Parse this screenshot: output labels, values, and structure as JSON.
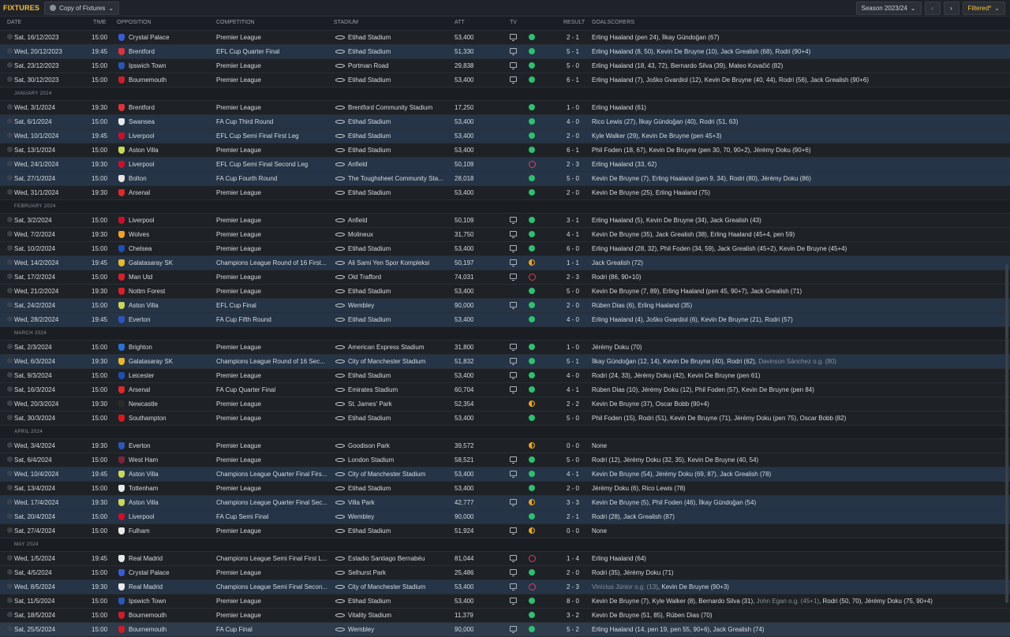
{
  "header": {
    "title": "FIXTURES",
    "view_label": "Copy of Fixtures",
    "season_label": "Season 2023/24",
    "filter_label": "Filtered*"
  },
  "columns": {
    "date": "DATE",
    "time": "TIME",
    "opposition": "OPPOSITION",
    "competition": "COMPETITION",
    "stadium": "STADIUM",
    "att": "ATT",
    "tv": "TV",
    "result": "RESULT",
    "goalscorers": "GOALSCORERS"
  },
  "colors": {
    "win": "#2fbf71",
    "loss": "#e0405a",
    "draw": "#e8a628",
    "accent": "#f3c13a"
  },
  "months": [
    "JANUARY 2024",
    "FEBRUARY 2024",
    "MARCH 2024",
    "APRIL 2024",
    "MAY 2024"
  ],
  "fixtures": [
    {
      "date": "Sat, 16/12/2023",
      "time": "15:00",
      "opp": "Crystal Palace",
      "crest": "#3a5bd0",
      "comp": "Premier League",
      "stadium": "Etihad Stadium",
      "att": "53,400",
      "tv": true,
      "res": "W",
      "score": "2 - 1",
      "scorers": "Erling Haaland (pen 24), İlkay Gündoğan (67)",
      "hl": false
    },
    {
      "date": "Wed, 20/12/2023",
      "time": "19:45",
      "opp": "Brentford",
      "crest": "#d8343b",
      "comp": "EFL Cup Quarter Final",
      "stadium": "Etihad Stadium",
      "att": "51,330",
      "tv": true,
      "res": "W",
      "score": "5 - 1",
      "scorers": "Erling Haaland (8, 50), Kevin De Bruyne (10), Jack Grealish (68), Rodri (90+4)",
      "hl": true
    },
    {
      "date": "Sat, 23/12/2023",
      "time": "15:00",
      "opp": "Ipswich Town",
      "crest": "#2a56b3",
      "comp": "Premier League",
      "stadium": "Portman Road",
      "att": "29,838",
      "tv": true,
      "res": "W",
      "score": "5 - 0",
      "scorers": "Erling Haaland (18, 43, 72), Bernardo Silva (39), Mateo Kovačić (82)",
      "hl": false
    },
    {
      "date": "Sat, 30/12/2023",
      "time": "15:00",
      "opp": "Bournemouth",
      "crest": "#c81f2c",
      "comp": "Premier League",
      "stadium": "Etihad Stadium",
      "att": "53,400",
      "tv": true,
      "res": "W",
      "score": "6 - 1",
      "scorers": "Erling Haaland (7), Joško Gvardiol (12), Kevin De Bruyne (40, 44), Rodri (56), Jack Grealish (90+6)",
      "hl": false
    },
    {
      "month": "JANUARY 2024"
    },
    {
      "date": "Wed, 3/1/2024",
      "time": "19:30",
      "opp": "Brentford",
      "crest": "#d8343b",
      "comp": "Premier League",
      "stadium": "Brentford Community Stadium",
      "att": "17,250",
      "tv": false,
      "res": "W",
      "score": "1 - 0",
      "scorers": "Erling Haaland (61)",
      "hl": false
    },
    {
      "date": "Sat, 6/1/2024",
      "time": "15:00",
      "opp": "Swansea",
      "crest": "#e9e9e9",
      "comp": "FA Cup Third Round",
      "stadium": "Etihad Stadium",
      "att": "53,400",
      "tv": false,
      "res": "W",
      "score": "4 - 0",
      "scorers": "Rico Lewis (27), İlkay Gündoğan (40), Rodri (51, 63)",
      "hl": true
    },
    {
      "date": "Wed, 10/1/2024",
      "time": "19:45",
      "opp": "Liverpool",
      "crest": "#c8102e",
      "comp": "EFL Cup Semi Final First Leg",
      "stadium": "Etihad Stadium",
      "att": "53,400",
      "tv": false,
      "res": "W",
      "score": "2 - 0",
      "scorers": "Kyle Walker (29), Kevin De Bruyne (pen 45+3)",
      "hl": true
    },
    {
      "date": "Sat, 13/1/2024",
      "time": "15:00",
      "opp": "Aston Villa",
      "crest": "#c9d65a",
      "comp": "Premier League",
      "stadium": "Etihad Stadium",
      "att": "53,400",
      "tv": false,
      "res": "W",
      "score": "6 - 1",
      "scorers": "Phil Foden (18, 67), Kevin De Bruyne (pen 30, 70, 90+2), Jérémy Doku (90+6)",
      "hl": false
    },
    {
      "date": "Wed, 24/1/2024",
      "time": "19:30",
      "opp": "Liverpool",
      "crest": "#c8102e",
      "comp": "EFL Cup Semi Final Second Leg",
      "stadium": "Anfield",
      "att": "50,109",
      "tv": false,
      "res": "L",
      "score": "2 - 3",
      "scorers": "Erling Haaland (33, 62)",
      "hl": true
    },
    {
      "date": "Sat, 27/1/2024",
      "time": "15:00",
      "opp": "Bolton",
      "crest": "#e6e6e6",
      "comp": "FA Cup Fourth Round",
      "stadium": "The Toughsheet Community Sta...",
      "att": "28,018",
      "tv": false,
      "res": "W",
      "score": "5 - 0",
      "scorers": "Kevin De Bruyne (7), Erling Haaland (pen 9, 34), Rodri (80), Jérémy Doku (86)",
      "hl": true
    },
    {
      "date": "Wed, 31/1/2024",
      "time": "19:30",
      "opp": "Arsenal",
      "crest": "#db2a2a",
      "comp": "Premier League",
      "stadium": "Etihad Stadium",
      "att": "53,400",
      "tv": false,
      "res": "W",
      "score": "2 - 0",
      "scorers": "Kevin De Bruyne (25), Erling Haaland (75)",
      "hl": false
    },
    {
      "month": "FEBRUARY 2024"
    },
    {
      "date": "Sat, 3/2/2024",
      "time": "15:00",
      "opp": "Liverpool",
      "crest": "#c8102e",
      "comp": "Premier League",
      "stadium": "Anfield",
      "att": "50,109",
      "tv": true,
      "res": "W",
      "score": "3 - 1",
      "scorers": "Erling Haaland (5), Kevin De Bruyne (34), Jack Grealish (43)",
      "hl": false
    },
    {
      "date": "Wed, 7/2/2024",
      "time": "19:30",
      "opp": "Wolves",
      "crest": "#f0a12d",
      "comp": "Premier League",
      "stadium": "Molineux",
      "att": "31,750",
      "tv": true,
      "res": "W",
      "score": "4 - 1",
      "scorers": "Kevin De Bruyne (35), Jack Grealish (38), Erling Haaland (45+4, pen 59)",
      "hl": false
    },
    {
      "date": "Sat, 10/2/2024",
      "time": "15:00",
      "opp": "Chelsea",
      "crest": "#1b4fb5",
      "comp": "Premier League",
      "stadium": "Etihad Stadium",
      "att": "53,400",
      "tv": true,
      "res": "W",
      "score": "6 - 0",
      "scorers": "Erling Haaland (28, 32), Phil Foden (34, 59), Jack Grealish (45+2), Kevin De Bruyne (45+4)",
      "hl": false
    },
    {
      "date": "Wed, 14/2/2024",
      "time": "19:45",
      "opp": "Galatasaray SK",
      "crest": "#e6b632",
      "comp": "Champions League Round of 16 First...",
      "stadium": "Ali Sami Yen Spor Kompleksi",
      "att": "50,197",
      "tv": true,
      "res": "D",
      "score": "1 - 1",
      "scorers": "Jack Grealish (72)",
      "hl": true
    },
    {
      "date": "Sat, 17/2/2024",
      "time": "15:00",
      "opp": "Man Utd",
      "crest": "#d3202f",
      "comp": "Premier League",
      "stadium": "Old Trafford",
      "att": "74,031",
      "tv": true,
      "res": "L",
      "score": "2 - 3",
      "scorers": "Rodri (86, 90+10)",
      "hl": false
    },
    {
      "date": "Wed, 21/2/2024",
      "time": "19:30",
      "opp": "Nottm Forest",
      "crest": "#d2222c",
      "comp": "Premier League",
      "stadium": "Etihad Stadium",
      "att": "53,400",
      "tv": false,
      "res": "W",
      "score": "5 - 0",
      "scorers": "Kevin De Bruyne (7, 89), Erling Haaland (pen 45, 90+7), Jack Grealish (71)",
      "hl": false
    },
    {
      "date": "Sat, 24/2/2024",
      "time": "15:00",
      "opp": "Aston Villa",
      "crest": "#c9d65a",
      "comp": "EFL Cup Final",
      "stadium": "Wembley",
      "att": "90,000",
      "tv": true,
      "res": "W",
      "score": "2 - 0",
      "scorers": "Rúben Dias (6), Erling Haaland (35)",
      "hl": true
    },
    {
      "date": "Wed, 28/2/2024",
      "time": "19:45",
      "opp": "Everton",
      "crest": "#2f55b8",
      "comp": "FA Cup Fifth Round",
      "stadium": "Etihad Stadium",
      "att": "53,400",
      "tv": false,
      "res": "W",
      "score": "4 - 0",
      "scorers": "Erling Haaland (4), Joško Gvardiol (6), Kevin De Bruyne (21), Rodri (57)",
      "hl": true
    },
    {
      "month": "MARCH 2024"
    },
    {
      "date": "Sat, 2/3/2024",
      "time": "15:00",
      "opp": "Brighton",
      "crest": "#2b6fd1",
      "comp": "Premier League",
      "stadium": "American Express Stadium",
      "att": "31,800",
      "tv": true,
      "res": "W",
      "score": "1 - 0",
      "scorers": "Jérémy Doku (70)",
      "hl": false
    },
    {
      "date": "Wed, 6/3/2024",
      "time": "19:30",
      "opp": "Galatasaray SK",
      "crest": "#e6b632",
      "comp": "Champions League Round of 16 Sec...",
      "stadium": "City of Manchester Stadium",
      "att": "51,832",
      "tv": true,
      "res": "W",
      "score": "5 - 1",
      "scorers": "İlkay Gündoğan (12, 14), Kevin De Bruyne (40), Rodri (62), ",
      "og": "Davinson Sánchez o.g. (80)",
      "hl": true
    },
    {
      "date": "Sat, 9/3/2024",
      "time": "15:00",
      "opp": "Leicester",
      "crest": "#1e4fb0",
      "comp": "Premier League",
      "stadium": "Etihad Stadium",
      "att": "53,400",
      "tv": true,
      "res": "W",
      "score": "4 - 0",
      "scorers": "Rodri (24, 33), Jérémy Doku (42), Kevin De Bruyne (pen 61)",
      "hl": false
    },
    {
      "date": "Sat, 16/3/2024",
      "time": "15:00",
      "opp": "Arsenal",
      "crest": "#db2a2a",
      "comp": "FA Cup Quarter Final",
      "stadium": "Emirates Stadium",
      "att": "60,704",
      "tv": true,
      "res": "W",
      "score": "4 - 1",
      "scorers": "Rúben Dias (10), Jérémy Doku (12), Phil Foden (57), Kevin De Bruyne (pen 84)",
      "hl": false
    },
    {
      "date": "Wed, 20/3/2024",
      "time": "19:30",
      "opp": "Newcastle",
      "crest": "#2b2b2b",
      "comp": "Premier League",
      "stadium": "St. James' Park",
      "att": "52,354",
      "tv": false,
      "res": "D",
      "score": "2 - 2",
      "scorers": "Kevin De Bruyne (37), Oscar Bobb (90+4)",
      "hl": false
    },
    {
      "date": "Sat, 30/3/2024",
      "time": "15:00",
      "opp": "Southampton",
      "crest": "#d71920",
      "comp": "Premier League",
      "stadium": "Etihad Stadium",
      "att": "53,400",
      "tv": false,
      "res": "W",
      "score": "5 - 0",
      "scorers": "Phil Foden (15), Rodri (51), Kevin De Bruyne (71), Jérémy Doku (pen 75), Oscar Bobb (82)",
      "hl": false
    },
    {
      "month": "APRIL 2024"
    },
    {
      "date": "Wed, 3/4/2024",
      "time": "19:30",
      "opp": "Everton",
      "crest": "#2f55b8",
      "comp": "Premier League",
      "stadium": "Goodison Park",
      "att": "39,572",
      "tv": false,
      "res": "D",
      "score": "0 - 0",
      "scorers": "None",
      "hl": false
    },
    {
      "date": "Sat, 6/4/2024",
      "time": "15:00",
      "opp": "West Ham",
      "crest": "#7a263a",
      "comp": "Premier League",
      "stadium": "London Stadium",
      "att": "58,521",
      "tv": true,
      "res": "W",
      "score": "5 - 0",
      "scorers": "Rodri (12), Jérémy Doku (32, 35), Kevin De Bruyne (40, 54)",
      "hl": false
    },
    {
      "date": "Wed, 10/4/2024",
      "time": "19:45",
      "opp": "Aston Villa",
      "crest": "#c9d65a",
      "comp": "Champions League Quarter Final Firs...",
      "stadium": "City of Manchester Stadium",
      "att": "53,400",
      "tv": true,
      "res": "W",
      "score": "4 - 1",
      "scorers": "Kevin De Bruyne (54), Jérémy Doku (69, 87), Jack Grealish (78)",
      "hl": true
    },
    {
      "date": "Sat, 13/4/2024",
      "time": "15:00",
      "opp": "Tottenham",
      "crest": "#e9e9e9",
      "comp": "Premier League",
      "stadium": "Etihad Stadium",
      "att": "53,400",
      "tv": false,
      "res": "W",
      "score": "2 - 0",
      "scorers": "Jérémy Doku (6), Rico Lewis (78)",
      "hl": false
    },
    {
      "date": "Wed, 17/4/2024",
      "time": "19:30",
      "opp": "Aston Villa",
      "crest": "#c9d65a",
      "comp": "Champions League Quarter Final Sec...",
      "stadium": "Villa Park",
      "att": "42,777",
      "tv": true,
      "res": "D",
      "score": "3 - 3",
      "scorers": "Kevin De Bruyne (5), Phil Foden (46), İlkay Gündoğan (54)",
      "hl": true
    },
    {
      "date": "Sat, 20/4/2024",
      "time": "15:00",
      "opp": "Liverpool",
      "crest": "#c8102e",
      "comp": "FA Cup Semi Final",
      "stadium": "Wembley",
      "att": "90,000",
      "tv": false,
      "res": "W",
      "score": "2 - 1",
      "scorers": "Rodri (28), Jack Grealish (87)",
      "hl": true
    },
    {
      "date": "Sat, 27/4/2024",
      "time": "15:00",
      "opp": "Fulham",
      "crest": "#e9e9e9",
      "comp": "Premier League",
      "stadium": "Etihad Stadium",
      "att": "51,924",
      "tv": true,
      "res": "D",
      "score": "0 - 0",
      "scorers": "None",
      "hl": false
    },
    {
      "month": "MAY 2024"
    },
    {
      "date": "Wed, 1/5/2024",
      "time": "19:45",
      "opp": "Real Madrid",
      "crest": "#e9e9e9",
      "comp": "Champions League Semi Final First L...",
      "stadium": "Estadio Santiago Bernabéu",
      "att": "81,044",
      "tv": true,
      "res": "L",
      "score": "1 - 4",
      "scorers": "Erling Haaland (64)",
      "hl": false
    },
    {
      "date": "Sat, 4/5/2024",
      "time": "15:00",
      "opp": "Crystal Palace",
      "crest": "#3a5bd0",
      "comp": "Premier League",
      "stadium": "Selhurst Park",
      "att": "25,486",
      "tv": true,
      "res": "W",
      "score": "2 - 0",
      "scorers": "Rodri (35), Jérémy Doku (71)",
      "hl": false
    },
    {
      "date": "Wed, 8/5/2024",
      "time": "19:30",
      "opp": "Real Madrid",
      "crest": "#e9e9e9",
      "comp": "Champions League Semi Final Secon...",
      "stadium": "City of Manchester Stadium",
      "att": "53,400",
      "tv": true,
      "res": "L",
      "score": "2 - 3",
      "scorers": "",
      "og": "Vinícius Júnior o.g. (13)",
      "after": ", Kevin De Bruyne (90+3)",
      "hl": true
    },
    {
      "date": "Sat, 11/5/2024",
      "time": "15:00",
      "opp": "Ipswich Town",
      "crest": "#2a56b3",
      "comp": "Premier League",
      "stadium": "Etihad Stadium",
      "att": "53,400",
      "tv": true,
      "res": "W",
      "score": "8 - 0",
      "scorers": "Kevin De Bruyne (7), Kyle Walker (8), Bernardo Silva (31), ",
      "og": "John Egan o.g. (45+1)",
      "after": ", Rodri (50, 70), Jérémy Doku (75, 90+4)",
      "hl": false
    },
    {
      "date": "Sat, 18/5/2024",
      "time": "15:00",
      "opp": "Bournemouth",
      "crest": "#c81f2c",
      "comp": "Premier League",
      "stadium": "Vitality Stadium",
      "att": "11,379",
      "tv": false,
      "res": "W",
      "score": "3 - 2",
      "scorers": "Kevin De Bruyne (51, 85), Rúben Dias (70)",
      "hl": false
    },
    {
      "date": "Sat, 25/5/2024",
      "time": "15:00",
      "opp": "Bournemouth",
      "crest": "#c81f2c",
      "comp": "FA Cup Final",
      "stadium": "Wembley",
      "att": "90,000",
      "tv": true,
      "res": "W",
      "score": "5 - 2",
      "scorers": "Erling Haaland (14, pen 19, pen 55, 90+6), Jack Grealish (74)",
      "hl": false,
      "last": true
    }
  ]
}
